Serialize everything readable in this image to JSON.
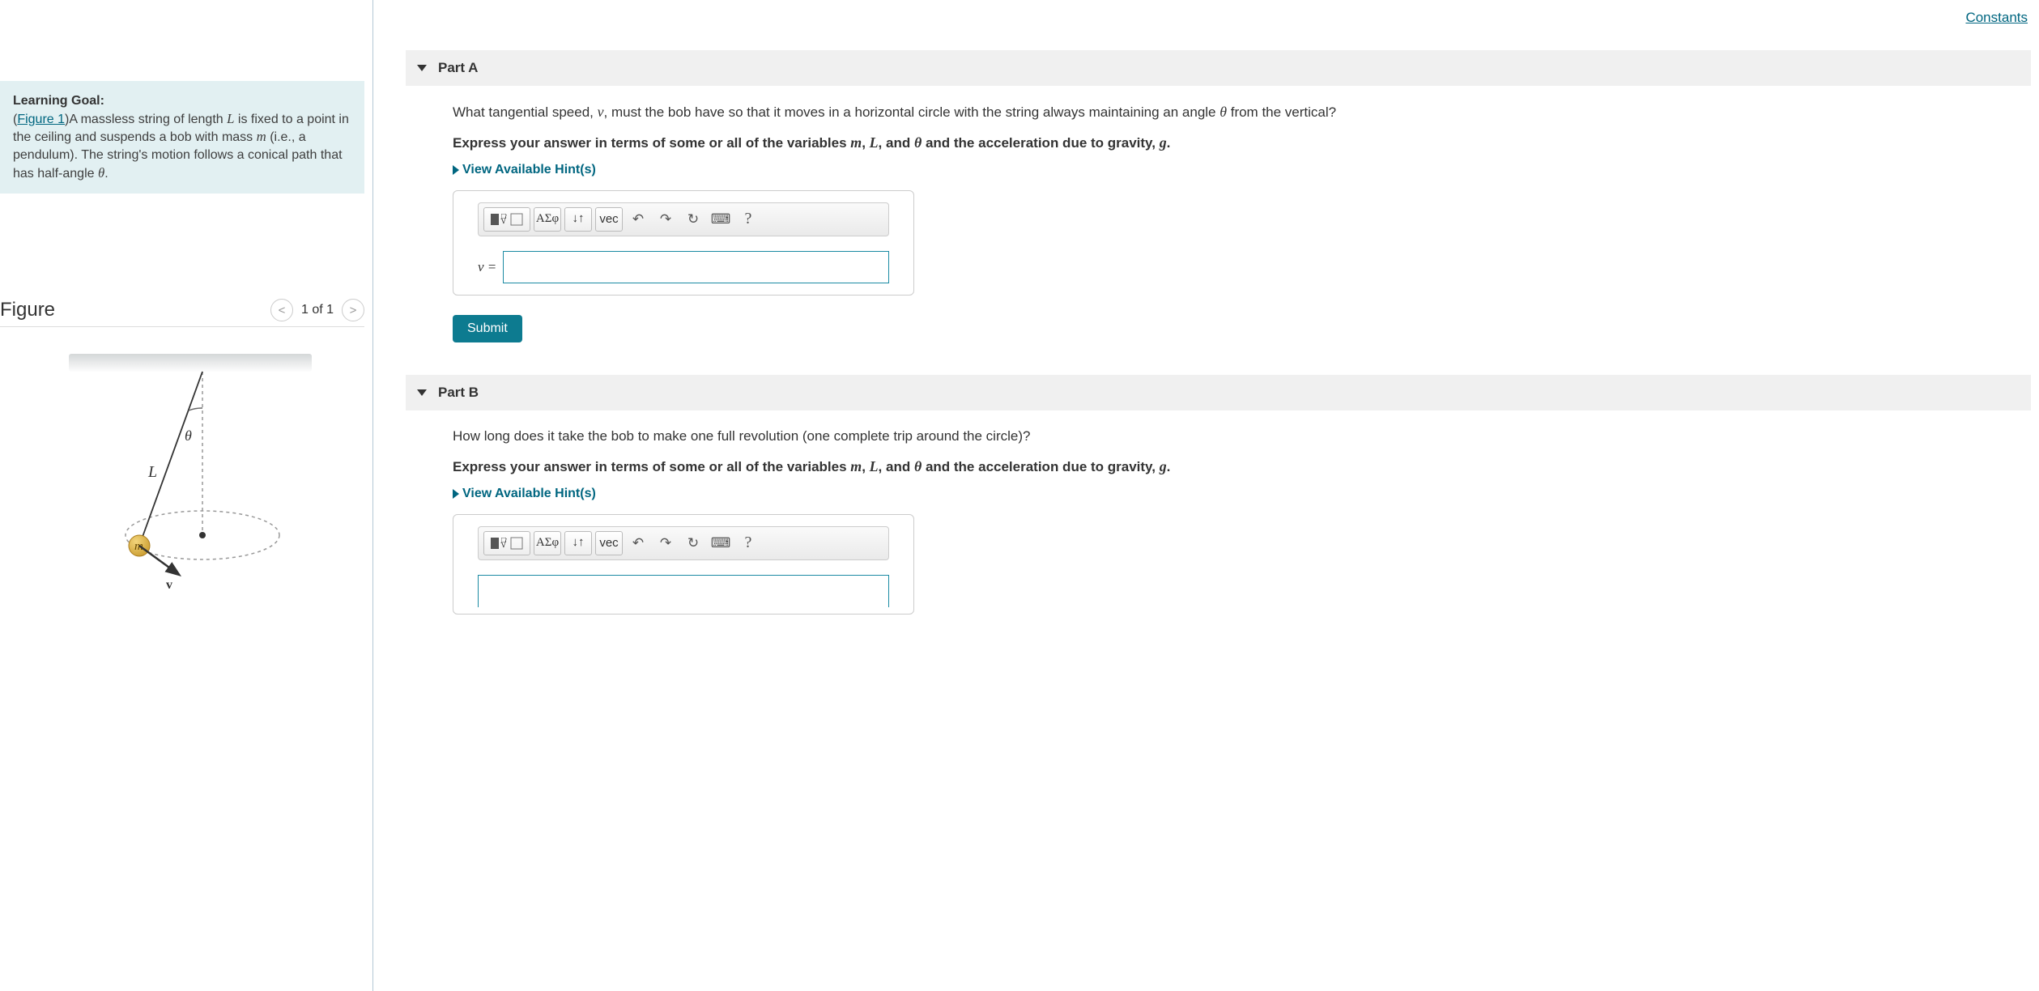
{
  "top": {
    "constants": "Constants"
  },
  "learning_goal": {
    "heading": "Learning Goal:",
    "figure_link": "Figure 1",
    "text_before_L": "A massless string of length ",
    "var_L": "L",
    "text_after_L": " is fixed to a point in the ceiling and suspends a bob with mass ",
    "var_m": "m",
    "text_after_m": " (i.e., a pendulum). The string's motion follows a conical path that has half-angle ",
    "var_theta": "θ",
    "text_end": "."
  },
  "figure": {
    "title": "Figure",
    "counter": "1 of 1"
  },
  "figure_svg": {
    "label_L": "L",
    "label_theta": "θ",
    "label_m": "m",
    "label_v": "v"
  },
  "partA": {
    "header": "Part A",
    "q1": "What tangential speed, ",
    "var_v": "v",
    "q2": ", must the bob have so that it moves in a horizontal circle with the string always maintaining an angle ",
    "var_theta": "θ",
    "q3": " from the vertical?",
    "instr1": "Express your answer in terms of some or all of the variables ",
    "var_m": "m",
    "instr_comma": ", ",
    "var_L": "L",
    "instr_and": ", and ",
    "var_theta2": "θ",
    "instr2": " and the acceleration due to gravity, ",
    "var_g": "g",
    "instr_end": ".",
    "hints": "View Available Hint(s)",
    "lhs": "v =",
    "submit": "Submit"
  },
  "partB": {
    "header": "Part B",
    "q": "How long does it take the bob to make one full revolution (one complete trip around the circle)?",
    "instr1": "Express your answer in terms of some or all of the variables ",
    "var_m": "m",
    "instr_comma": ", ",
    "var_L": "L",
    "instr_and": ", and ",
    "var_theta": "θ",
    "instr2": " and the acceleration due to gravity, ",
    "var_g": "g",
    "instr_end": ".",
    "hints": "View Available Hint(s)"
  },
  "toolbar": {
    "greek": "ΑΣφ",
    "subsup": "↓↑",
    "vec": "vec",
    "undo": "↶",
    "redo": "↷",
    "reset": "↻",
    "keyboard": "⌨",
    "help": "?"
  }
}
